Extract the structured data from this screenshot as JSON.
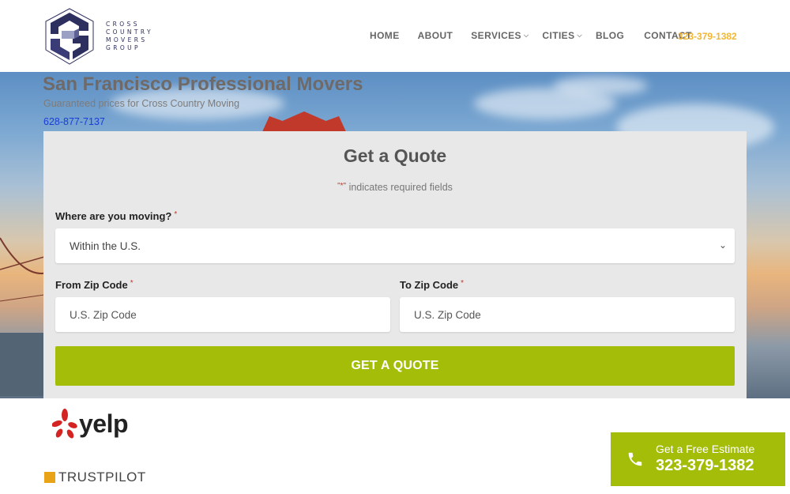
{
  "logo": {
    "text_lines": [
      "CROSS",
      "COUNTRY",
      "MOVERS",
      "GROUP"
    ]
  },
  "nav": {
    "items": [
      {
        "label": "HOME",
        "has_dropdown": false
      },
      {
        "label": "ABOUT",
        "has_dropdown": false
      },
      {
        "label": "SERVICES",
        "has_dropdown": true
      },
      {
        "label": "CITIES",
        "has_dropdown": true
      },
      {
        "label": "BLOG",
        "has_dropdown": false
      },
      {
        "label": "CONTACT",
        "has_dropdown": false
      }
    ],
    "phone": "323-379-1382"
  },
  "hero": {
    "title": "San Francisco Professional Movers",
    "subtitle": "Guaranteed prices for Cross Country Moving",
    "phone": "628-877-7137"
  },
  "quote_form": {
    "title": "Get a Quote",
    "required_marker": "\"*\"",
    "required_note": " indicates required fields",
    "moving_label": "Where are you moving?",
    "moving_value": "Within the U.S.",
    "from_label": "From Zip Code",
    "from_placeholder": "U.S. Zip Code",
    "to_label": "To Zip Code",
    "to_placeholder": "U.S. Zip Code",
    "asterisk": "*",
    "submit_label": "GET A QUOTE"
  },
  "badges": {
    "yelp": "yelp",
    "trustpilot": "TRUSTPILOT"
  },
  "estimate_cta": {
    "line1": "Get a Free Estimate",
    "phone": "323-379-1382"
  },
  "colors": {
    "accent_green": "#a4bd09",
    "phone_orange": "#f2b632",
    "required_red": "#c0392b",
    "logo_navy": "#2d2f5e"
  }
}
